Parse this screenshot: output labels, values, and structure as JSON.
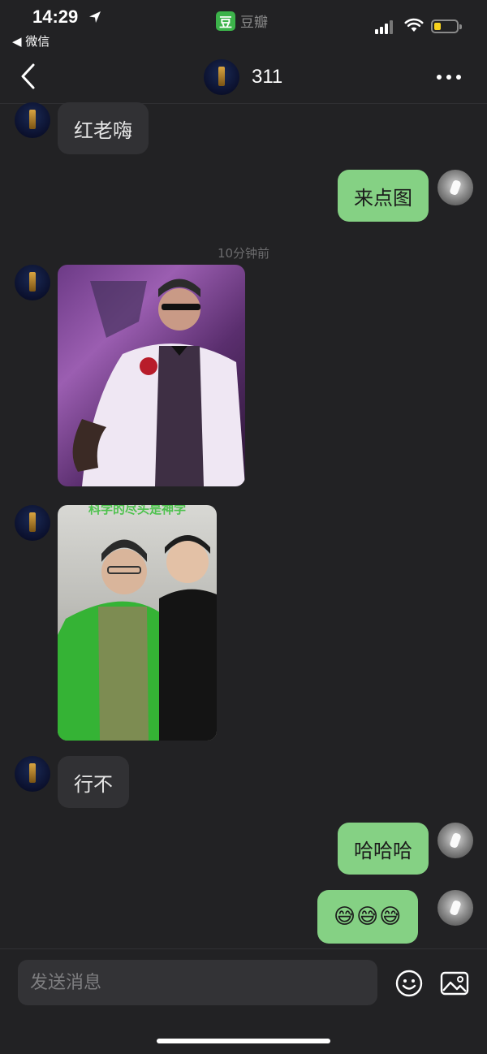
{
  "status_bar": {
    "time": "14:29",
    "back_app": "◀ 微信",
    "app_logo": "豆",
    "app_name": "豆瓣",
    "battery_level": 0.3,
    "battery_color": "#f7d21e"
  },
  "nav": {
    "title": "311",
    "back_icon": "chevron-left-icon",
    "more_icon": "more-icon"
  },
  "messages": {
    "m1": "红老嗨",
    "m2": "来点图",
    "timestamp": "10分钟前",
    "m5": "行不",
    "m6": "哈哈哈",
    "m7": "😅😅😅"
  },
  "images": {
    "photo2_caption": "科学的尽头是神学"
  },
  "composer": {
    "placeholder": "发送消息",
    "emoji_icon": "smiley-icon",
    "image_icon": "image-icon"
  },
  "colors": {
    "background": "#222224",
    "my_bubble": "#85d184",
    "their_bubble": "#313134",
    "brand_green": "#3cb34a"
  }
}
